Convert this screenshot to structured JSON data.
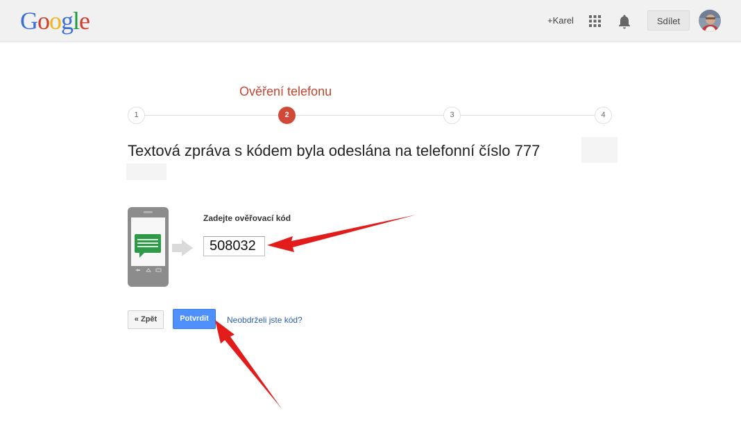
{
  "header": {
    "logo_letters": [
      "G",
      "o",
      "o",
      "g",
      "l",
      "e"
    ],
    "user_link": "+Karel",
    "share_label": "Sdílet",
    "icons": [
      "apps-icon",
      "notifications-bell-icon"
    ]
  },
  "steps": {
    "current_title": "Ověření telefonu",
    "items": [
      "1",
      "2",
      "3",
      "4"
    ],
    "active_index": 2
  },
  "main": {
    "headline": "Textová zpráva s kódem byla odeslána na telefonní číslo 777",
    "code_label": "Zadejte ověřovací kód",
    "code_value": "508032"
  },
  "actions": {
    "back_label": "« Zpět",
    "confirm_label": "Potvrdit",
    "resend_link": "Neobdrželi jste kód?"
  },
  "colors": {
    "accent_red": "#d14836",
    "title_red": "#c0452f",
    "confirm_blue": "#4d90fe",
    "link_blue": "#2a5db0",
    "annotation_arrow": "#e21b1b"
  }
}
